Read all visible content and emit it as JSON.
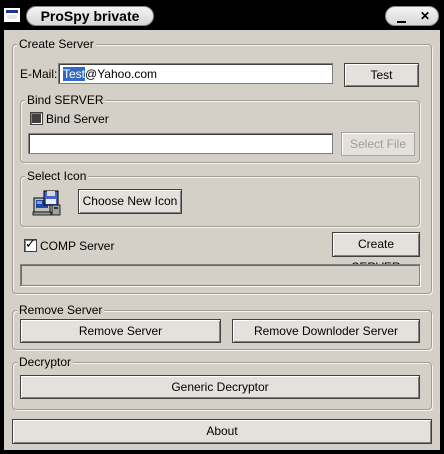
{
  "window": {
    "title": "ProSpy brivate",
    "minimize_glyph": "",
    "close_glyph": "✕"
  },
  "create_server": {
    "group_label": "Create Server",
    "email_label": "E-Mail:",
    "email_selected": "Test",
    "email_rest": "@Yahoo.com",
    "test_button": "Test",
    "bind_group_label": "Bind SERVER",
    "bind_checkbox_label": "Bind Server",
    "bind_checkbox_state": "mixed",
    "bind_file_path": "",
    "select_file_button": "Select File",
    "select_icon_group_label": "Select Icon",
    "icon_preview": "computer-with-disk-icon",
    "choose_icon_button": "Choose New Icon",
    "comp_checkbox_label": "COMP Server",
    "comp_checkbox_checked": true,
    "create_button": "Create SERVER",
    "progress_value": 0
  },
  "remove_server": {
    "group_label": "Remove Server",
    "remove_button": "Remove Server",
    "remove_downloader_button": "Remove Downloder Server"
  },
  "decryptor": {
    "group_label": "Decryptor",
    "generic_button": "Generic Decryptor"
  },
  "about_button": "About"
}
